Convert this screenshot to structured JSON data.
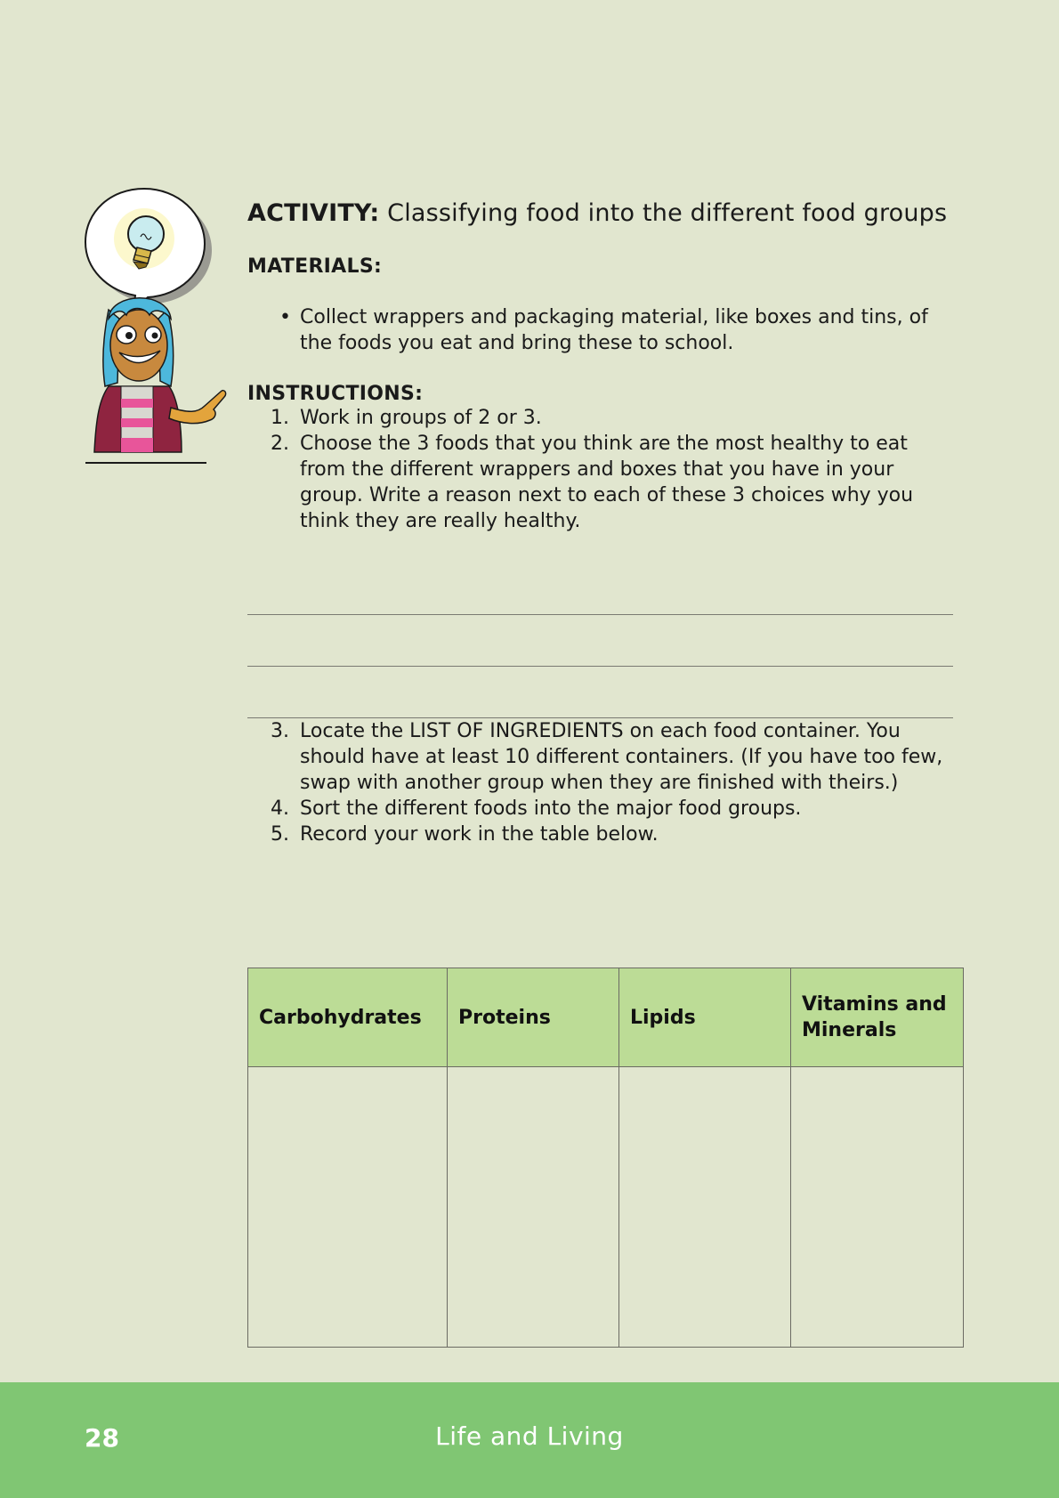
{
  "activity": {
    "label": "ACTIVITY:",
    "title": "Classifying food into the different food groups"
  },
  "materials": {
    "heading": "MATERIALS:",
    "items": [
      "Collect wrappers and packaging material, like boxes and tins, of the foods you eat and bring these to school."
    ]
  },
  "instructions": {
    "heading": "INSTRUCTIONS:",
    "steps": [
      {
        "num": "1.",
        "text": "Work in groups of 2 or 3."
      },
      {
        "num": "2.",
        "text": "Choose the 3 foods that you think are the most healthy to eat from the different wrappers and boxes that you have in your group.  Write a reason next to each of these 3 choices why you think they are really healthy."
      },
      {
        "num": "3.",
        "text": "Locate the LIST OF INGREDIENTS on each food container. You should have at least 10 different containers. (If you have too few, swap with another group when they are finished with theirs.)"
      },
      {
        "num": "4.",
        "text": "Sort the different foods into the major food groups."
      },
      {
        "num": "5.",
        "text": "Record your work in the table below."
      }
    ]
  },
  "table": {
    "headers": [
      "Carbohydrates",
      "Proteins",
      "Lipids",
      "Vitamins and Minerals"
    ]
  },
  "footer": {
    "page_number": "28",
    "title": "Life and Living"
  },
  "colors": {
    "page_background": "#e1e6cf",
    "footer_background": "#80c673",
    "table_header_background": "#bcdc96"
  },
  "icons": [
    "lightbulb-icon",
    "girl-character-illustration"
  ]
}
